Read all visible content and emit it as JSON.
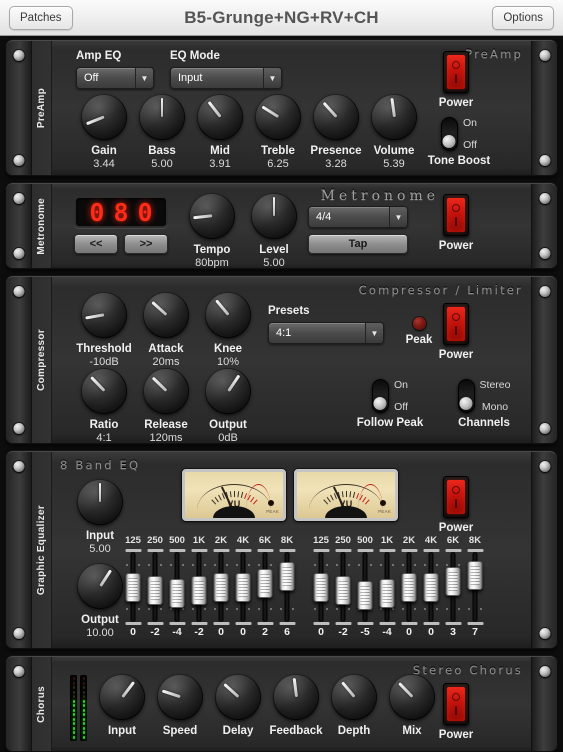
{
  "titlebar": {
    "patches_label": "Patches",
    "title": "B5-Grunge+NG+RV+CH",
    "options_label": "Options"
  },
  "preamp": {
    "side_label": "PreAmp",
    "brand": "PreAmp",
    "amp_eq_label": "Amp EQ",
    "amp_eq_value": "Off",
    "eq_mode_label": "EQ Mode",
    "eq_mode_value": "Input",
    "knobs": [
      {
        "name": "Gain",
        "value": "3.44",
        "angle": -112
      },
      {
        "name": "Bass",
        "value": "5.00",
        "angle": 0
      },
      {
        "name": "Mid",
        "value": "3.91",
        "angle": -38
      },
      {
        "name": "Treble",
        "value": "6.25",
        "angle": -58
      },
      {
        "name": "Presence",
        "value": "3.28",
        "angle": -42
      },
      {
        "name": "Volume",
        "value": "5.39",
        "angle": -8
      }
    ],
    "power_label": "Power",
    "tone_boost_label": "Tone Boost",
    "tone_boost_on": "On",
    "tone_boost_off": "Off",
    "tone_boost_state": "off"
  },
  "metronome": {
    "side_label": "Metronome",
    "brand": "Metronome",
    "display_digits": [
      "0",
      "8",
      "0"
    ],
    "prev_label": "<<",
    "next_label": ">>",
    "knobs": [
      {
        "name": "Tempo",
        "value": "80bpm",
        "angle": -96
      },
      {
        "name": "Level",
        "value": "5.00",
        "angle": 0
      }
    ],
    "time_sig_value": "4/4",
    "tap_label": "Tap",
    "power_label": "Power"
  },
  "compressor": {
    "side_label": "Compressor",
    "brand": "Compressor / Limiter",
    "knobs": [
      {
        "name": "Threshold",
        "value": "-10dB",
        "angle": -100
      },
      {
        "name": "Attack",
        "value": "20ms",
        "angle": -48
      },
      {
        "name": "Knee",
        "value": "10%",
        "angle": -40
      },
      {
        "name": "Ratio",
        "value": "4:1",
        "angle": -44
      },
      {
        "name": "Release",
        "value": "120ms",
        "angle": -46
      },
      {
        "name": "Output",
        "value": "0dB",
        "angle": 34
      }
    ],
    "presets_label": "Presets",
    "presets_value": "4:1",
    "peak_label": "Peak",
    "power_label": "Power",
    "follow_peak_label": "Follow Peak",
    "follow_peak_on": "On",
    "follow_peak_off": "Off",
    "follow_peak_state": "off",
    "channels_label": "Channels",
    "channels_on": "Stereo",
    "channels_off": "Mono",
    "channels_state": "off"
  },
  "equalizer": {
    "side_label": "Graphic Equalizer",
    "brand": "8 Band EQ",
    "knobs": [
      {
        "name": "Input",
        "value": "5.00",
        "angle": 0
      },
      {
        "name": "Output",
        "value": "10.00",
        "angle": 33
      }
    ],
    "power_label": "Power",
    "vu_label": "VU",
    "vu_peak_label": "PEAK",
    "frequencies": [
      "125",
      "250",
      "500",
      "1K",
      "2K",
      "4K",
      "6K",
      "8K"
    ],
    "left_values": [
      0,
      -2,
      -4,
      -2,
      0,
      0,
      2,
      6
    ],
    "right_values": [
      0,
      -2,
      -5,
      -4,
      0,
      0,
      3,
      7
    ],
    "range": [
      -12,
      12
    ]
  },
  "chorus": {
    "side_label": "Chorus",
    "brand": "Stereo Chorus",
    "knobs": [
      {
        "name": "Input",
        "angle": 37
      },
      {
        "name": "Speed",
        "angle": -72
      },
      {
        "name": "Delay",
        "angle": -48
      },
      {
        "name": "Feedback",
        "angle": -7
      },
      {
        "name": "Depth",
        "angle": -40
      },
      {
        "name": "Mix",
        "angle": -44
      }
    ],
    "power_label": "Power",
    "meter_left_level": 9,
    "meter_right_level": 9
  },
  "colors": {
    "power_red": "#e8281e",
    "led_red": "#ff2a17",
    "vu_cream": "#f0e3b8",
    "panel": "#343434"
  }
}
